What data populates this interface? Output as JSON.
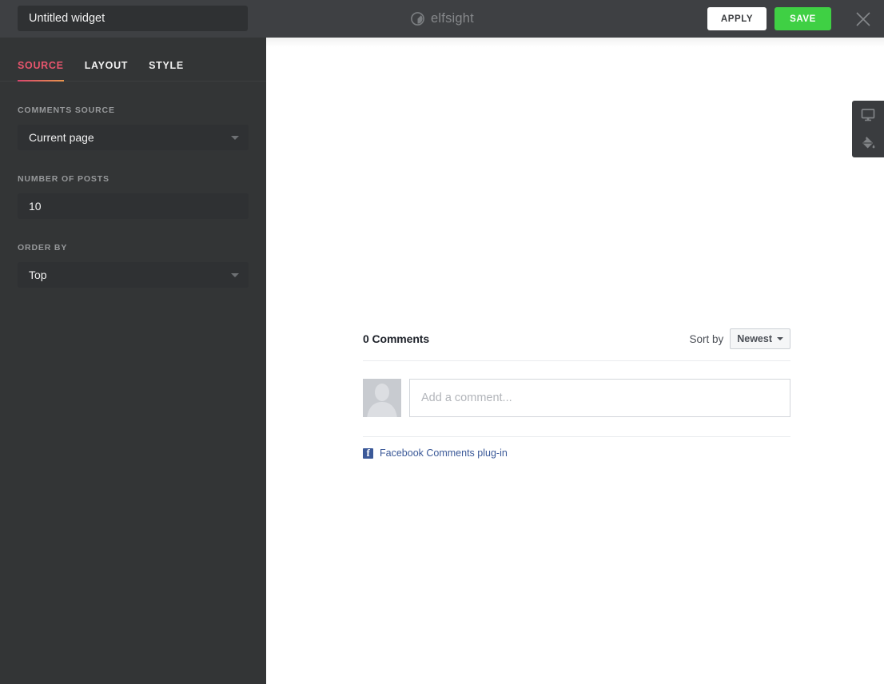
{
  "topbar": {
    "widget_title_value": "Untitled widget",
    "widget_title_placeholder": "Widget name",
    "brand_name": "elfsight",
    "apply_label": "APPLY",
    "save_label": "SAVE",
    "colors": {
      "bar_bg": "#3e4043",
      "save_green": "#3fd044",
      "apply_white": "#ffffff"
    }
  },
  "sidebar": {
    "tabs": [
      {
        "label": "SOURCE",
        "active": true
      },
      {
        "label": "LAYOUT",
        "active": false
      },
      {
        "label": "STYLE",
        "active": false
      }
    ],
    "active_tab_accent": "#e8556d",
    "fields": [
      {
        "label": "COMMENTS SOURCE",
        "type": "select",
        "value": "Current page"
      },
      {
        "label": "NUMBER OF POSTS",
        "type": "text",
        "value": "10",
        "placeholder": "10"
      },
      {
        "label": "ORDER BY",
        "type": "select",
        "value": "Top"
      }
    ]
  },
  "preview": {
    "facebook_comments": {
      "comments_count_label": "0 Comments",
      "sort_by_label": "Sort by",
      "sort_by_value": "Newest",
      "comment_placeholder": "Add a comment...",
      "footer_link": "Facebook Comments plug-in",
      "brand_color": "#3b5998"
    }
  },
  "toolpanel": {
    "buttons": [
      {
        "icon": "monitor-icon",
        "name": "device-preview"
      },
      {
        "icon": "paint-bucket-icon",
        "name": "background-fill"
      }
    ]
  }
}
